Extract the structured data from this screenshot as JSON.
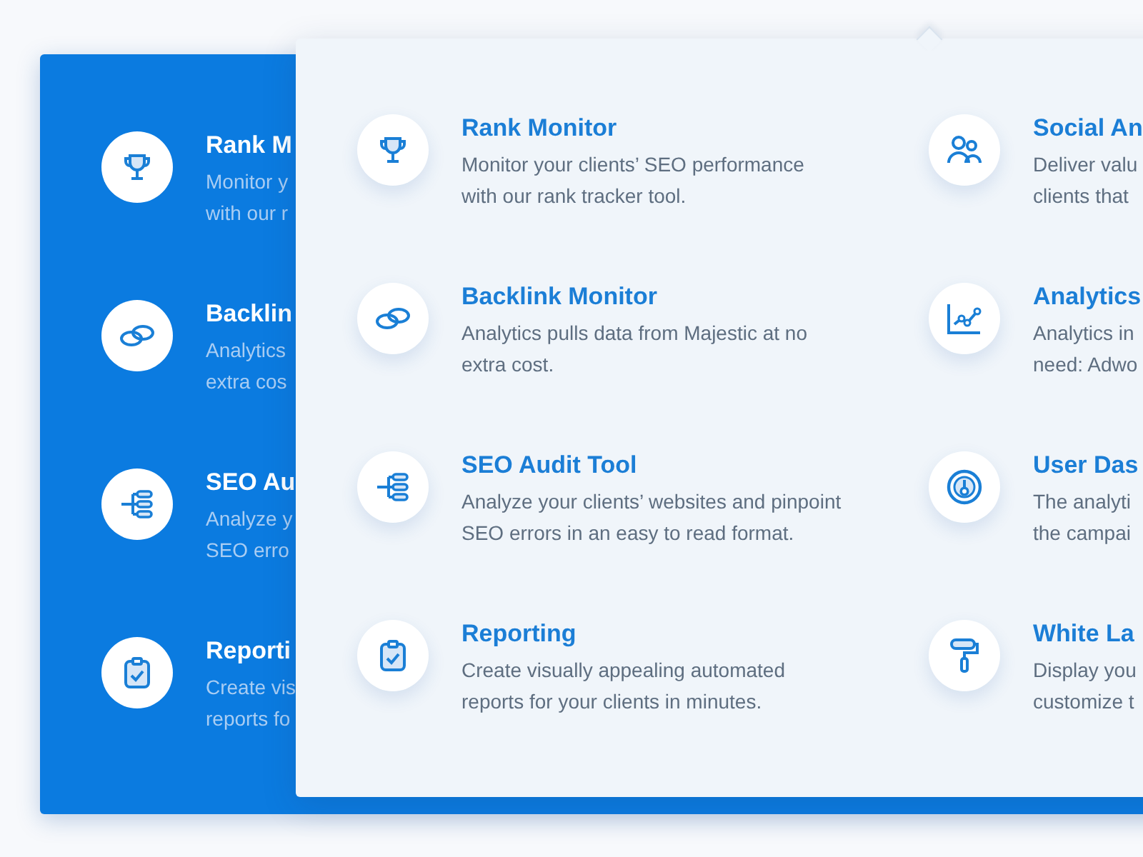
{
  "background_card": {
    "items": [
      {
        "title": "Rank M",
        "lines": [
          "Monitor y",
          "with our r"
        ]
      },
      {
        "title": "Backlin",
        "lines": [
          "Analytics",
          "extra cos"
        ]
      },
      {
        "title": "SEO Au",
        "lines": [
          "Analyze y",
          "SEO erro"
        ]
      },
      {
        "title": "Reporti",
        "lines": [
          "Create vis",
          "reports fo"
        ]
      }
    ]
  },
  "panel": {
    "columns": [
      {
        "items": [
          {
            "title": "Rank Monitor",
            "lines": [
              "Monitor your clients’ SEO performance",
              "with our rank tracker tool."
            ]
          },
          {
            "title": "Backlink Monitor",
            "lines": [
              "Analytics pulls data from Majestic at no",
              "extra cost."
            ]
          },
          {
            "title": "SEO Audit Tool",
            "lines": [
              "Analyze your clients’ websites and pinpoint",
              "SEO errors in an easy to read format."
            ]
          },
          {
            "title": "Reporting",
            "lines": [
              "Create visually appealing automated",
              "reports for your clients in minutes."
            ]
          }
        ]
      },
      {
        "items": [
          {
            "title": "Social An",
            "lines": [
              "Deliver valu",
              "clients that"
            ]
          },
          {
            "title": "Analytics",
            "lines": [
              "Analytics in",
              "need: Adwo"
            ]
          },
          {
            "title": "User Das",
            "lines": [
              "The analyti",
              "the campai"
            ]
          },
          {
            "title": "White La",
            "lines": [
              "Display you",
              "customize t"
            ]
          }
        ]
      }
    ]
  }
}
